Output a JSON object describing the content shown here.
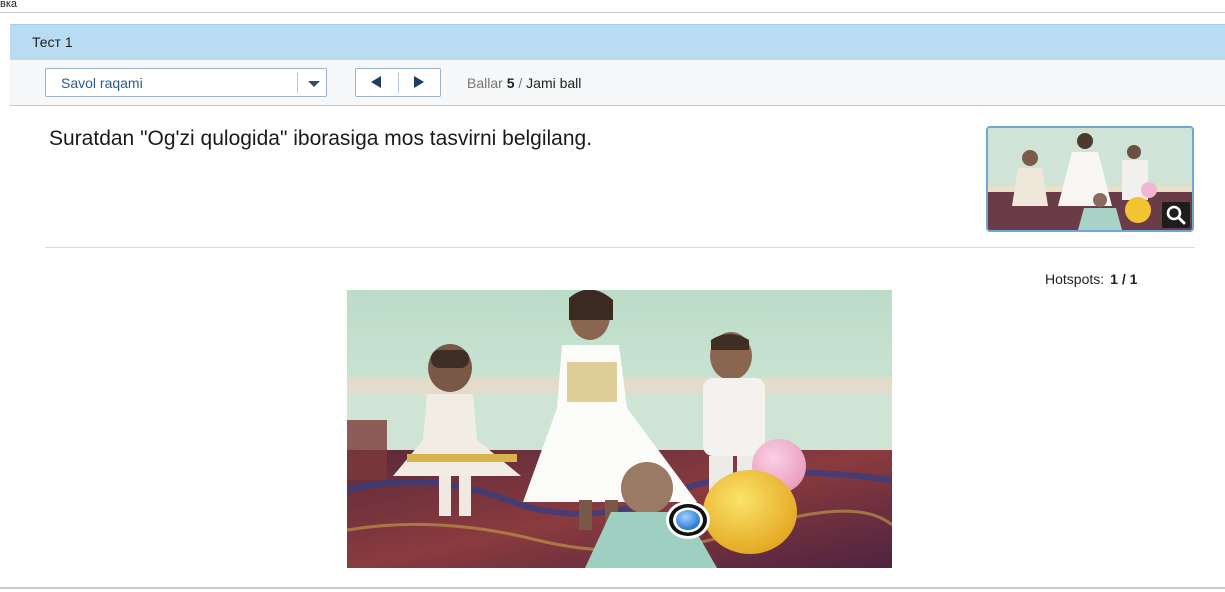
{
  "top_strip": {
    "text": "вка"
  },
  "test": {
    "title": "Тест 1"
  },
  "toolbar": {
    "question_select": {
      "label": "Savol raqami"
    },
    "score": {
      "label": "Ballar",
      "value": "5",
      "separator": "/",
      "total_label": "Jami ball"
    }
  },
  "question": {
    "text": "Suratdan \"Og'zi qulogida\" iborasiga mos tasvirni belgilang.",
    "thumbnail_icon": "magnifier-icon"
  },
  "hotspots": {
    "label": "Hotspots:",
    "value": "1 / 1"
  },
  "colors": {
    "title_bar": "#b9dcf3",
    "toolbar": "#f6f7f8",
    "accent": "#2a5d8a",
    "marker": "#2f8fe6"
  }
}
